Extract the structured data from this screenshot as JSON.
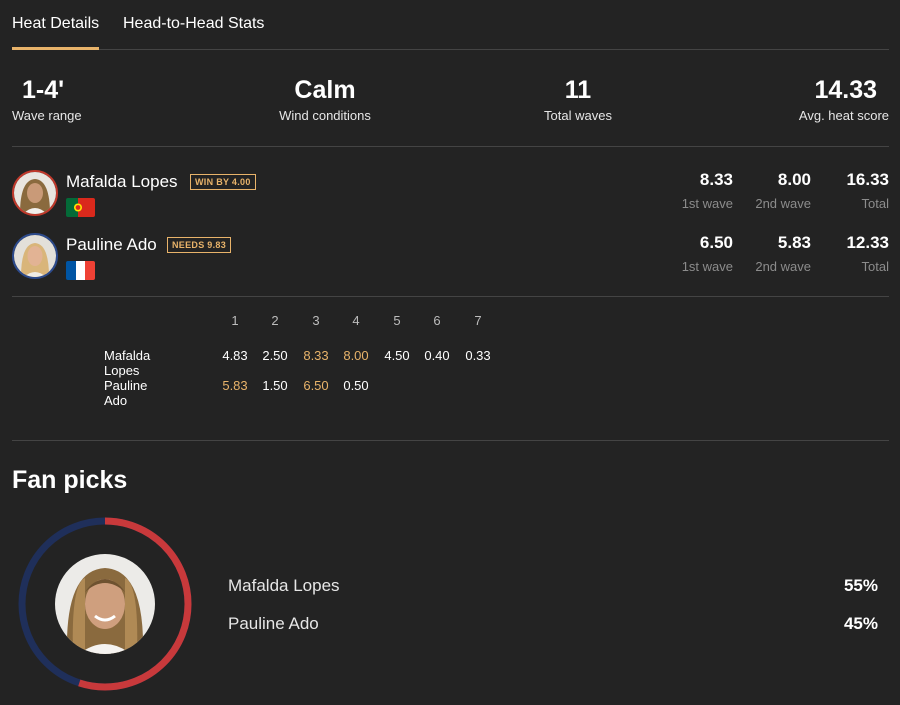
{
  "tabs": [
    {
      "label": "Heat Details",
      "active": true
    },
    {
      "label": "Head-to-Head Stats",
      "active": false
    }
  ],
  "conditions": {
    "wave_range": {
      "value": "1-4'",
      "label": "Wave range"
    },
    "wind": {
      "value": "Calm",
      "label": "Wind conditions"
    },
    "total_waves": {
      "value": "11",
      "label": "Total waves"
    },
    "avg_score": {
      "value": "14.33",
      "label": "Avg. heat score"
    }
  },
  "surfers": [
    {
      "name": "Mafalda Lopes",
      "badge": "WIN BY 4.00",
      "country": "Portugal",
      "ring_color": "#c0392b",
      "wave1": {
        "value": "8.33",
        "label": "1st wave"
      },
      "wave2": {
        "value": "8.00",
        "label": "2nd wave"
      },
      "total": {
        "value": "16.33",
        "label": "Total"
      }
    },
    {
      "name": "Pauline Ado",
      "badge": "NEEDS 9.83",
      "country": "France",
      "ring_color": "#2c4a8c",
      "wave1": {
        "value": "6.50",
        "label": "1st wave"
      },
      "wave2": {
        "value": "5.83",
        "label": "2nd wave"
      },
      "total": {
        "value": "12.33",
        "label": "Total"
      }
    }
  ],
  "wave_table": {
    "headers": [
      "1",
      "2",
      "3",
      "4",
      "5",
      "6",
      "7"
    ],
    "rows": [
      {
        "name": "Mafalda Lopes",
        "scores": [
          "4.83",
          "2.50",
          "8.33",
          "8.00",
          "4.50",
          "0.40",
          "0.33"
        ],
        "highlight": [
          2,
          3
        ]
      },
      {
        "name": "Pauline Ado",
        "scores": [
          "5.83",
          "1.50",
          "6.50",
          "0.50"
        ],
        "highlight": [
          0,
          2
        ]
      }
    ]
  },
  "fan_picks": {
    "title": "Fan picks",
    "picks": [
      {
        "name": "Mafalda Lopes",
        "percent": "55%",
        "share": 55,
        "color": "#c8393b"
      },
      {
        "name": "Pauline Ado",
        "percent": "45%",
        "share": 45,
        "color": "#1f2f5a"
      }
    ]
  },
  "colors": {
    "accent": "#e8b36a",
    "background": "#232323"
  }
}
